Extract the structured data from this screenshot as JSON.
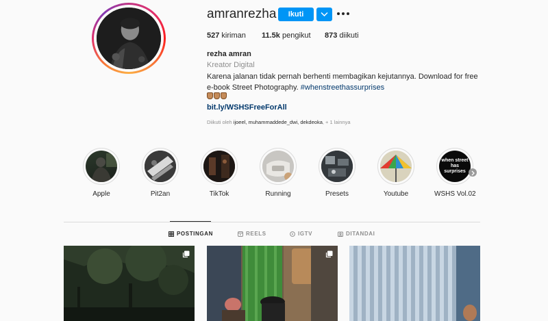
{
  "profile": {
    "username": "amranrezha",
    "follow_label": "Ikuti",
    "stats": {
      "posts_count": "527",
      "posts_label": "kiriman",
      "followers_count": "11.5k",
      "followers_label": "pengikut",
      "following_count": "873",
      "following_label": "diikuti"
    },
    "full_name": "rezha amran",
    "category": "Kreator Digital",
    "bio_text": "Karena jalanan tidak pernah berhenti membagikan kejutannya. Download for free e-book Street Photography.",
    "bio_hashtag": "#whenstreethassurprises",
    "link": "bit.ly/WSHSFreeForAll",
    "followed_by_prefix": "Diikuti oleh",
    "followed_by_users": "ijoeel, muhammaddede_dwi, dekdeoka",
    "followed_by_suffix": ", + 1 lainnya"
  },
  "highlights": [
    {
      "label": "Apple",
      "icon": "highlight-apple"
    },
    {
      "label": "Pit2an",
      "icon": "highlight-pit2an"
    },
    {
      "label": "TikTok",
      "icon": "highlight-tiktok"
    },
    {
      "label": "Running",
      "icon": "highlight-running"
    },
    {
      "label": "Presets",
      "icon": "highlight-presets"
    },
    {
      "label": "Youtube",
      "icon": "highlight-youtube"
    },
    {
      "label": "WSHS Vol.02",
      "icon": "highlight-wshs",
      "cover_text": "when street has surprises"
    }
  ],
  "tabs": [
    {
      "label": "POSTINGAN",
      "icon": "grid-icon",
      "active": true
    },
    {
      "label": "REELS",
      "icon": "reels-icon",
      "active": false
    },
    {
      "label": "IGTV",
      "icon": "igtv-icon",
      "active": false
    },
    {
      "label": "DITANDAI",
      "icon": "tagged-icon",
      "active": false
    }
  ],
  "colors": {
    "accent": "#0095f6",
    "link": "#00376b",
    "muted": "#8e8e8e",
    "background": "#fafafa"
  }
}
